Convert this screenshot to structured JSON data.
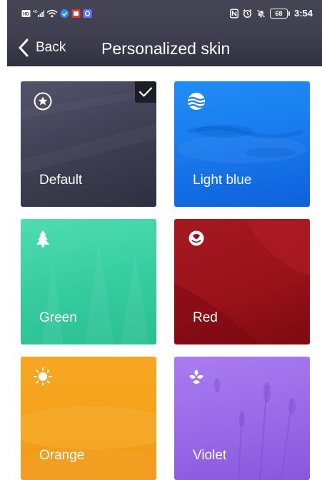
{
  "status_bar": {
    "time": "3:54",
    "battery": "68",
    "left_icons": [
      "hd-icon",
      "signal-icon",
      "wifi-icon",
      "app-icon-blue",
      "app-icon-red",
      "app-icon-purple"
    ],
    "right_icons": [
      "nfc-icon",
      "alarm-icon",
      "mute-icon"
    ]
  },
  "header": {
    "back_label": "Back",
    "title": "Personalized skin"
  },
  "skins": [
    {
      "id": "default",
      "label": "Default",
      "icon": "star-circle-icon",
      "selected": true,
      "color": "#3e3e52"
    },
    {
      "id": "light-blue",
      "label": "Light blue",
      "icon": "waves-icon",
      "selected": false,
      "color": "#1a7ef0"
    },
    {
      "id": "green",
      "label": "Green",
      "icon": "tree-icon",
      "selected": false,
      "color": "#37cd9f"
    },
    {
      "id": "red",
      "label": "Red",
      "icon": "rose-icon",
      "selected": false,
      "color": "#9a1219"
    },
    {
      "id": "orange",
      "label": "Orange",
      "icon": "sun-icon",
      "selected": false,
      "color": "#f5a11a"
    },
    {
      "id": "violet",
      "label": "Violet",
      "icon": "flower-icon",
      "selected": false,
      "color": "#9a6be8"
    }
  ],
  "colors": {
    "header_bg": "#3f3f50",
    "check_badge": "#1d1e28",
    "text": "#ffffff"
  }
}
